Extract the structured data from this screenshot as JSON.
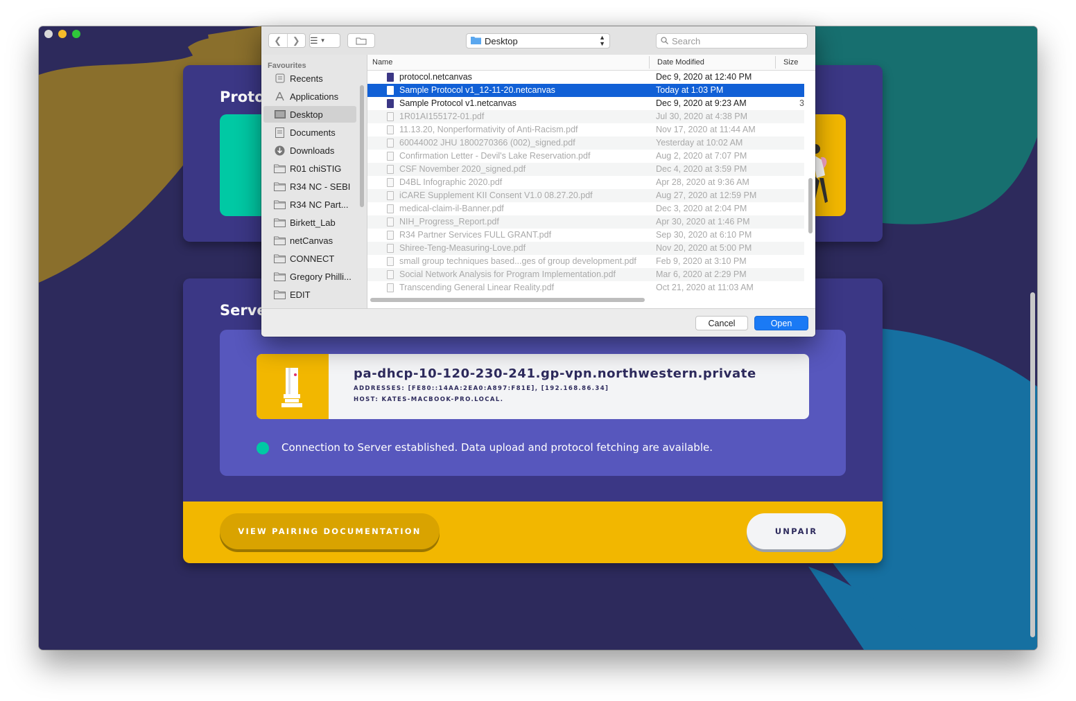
{
  "app": {
    "protocols_heading": "Protoc",
    "server_heading": "Server",
    "server": {
      "name": "pa-dhcp-10-120-230-241.gp-vpn.northwestern.private",
      "addresses": "ADDRESSES: [FE80::14AA:2EA0:A897:F81E], [192.168.86.34]",
      "host": "HOST: KATES-MACBOOK-PRO.LOCAL."
    },
    "status_text": "Connection to Server established. Data upload and protocol fetching are available.",
    "docs_button": "VIEW PAIRING DOCUMENTATION",
    "unpair_button": "UNPAIR",
    "colors": {
      "background": "#2d2a5c",
      "card": "#3b3785",
      "accent_green": "#00c9a4",
      "accent_yellow": "#f2b700",
      "panel": "#5757bd"
    }
  },
  "dialog": {
    "location": "Desktop",
    "search_placeholder": "Search",
    "sidebar": {
      "header": "Favourites",
      "items": [
        {
          "label": "Recents",
          "icon": "recents-icon"
        },
        {
          "label": "Applications",
          "icon": "applications-icon"
        },
        {
          "label": "Desktop",
          "icon": "desktop-icon",
          "active": true
        },
        {
          "label": "Documents",
          "icon": "documents-icon"
        },
        {
          "label": "Downloads",
          "icon": "downloads-icon"
        },
        {
          "label": "R01 chiSTIG",
          "icon": "folder-icon"
        },
        {
          "label": "R34 NC - SEBI",
          "icon": "folder-icon"
        },
        {
          "label": "R34 NC Part...",
          "icon": "folder-icon"
        },
        {
          "label": "Birkett_Lab",
          "icon": "folder-icon"
        },
        {
          "label": "netCanvas",
          "icon": "folder-icon"
        },
        {
          "label": "CONNECT",
          "icon": "folder-icon"
        },
        {
          "label": "Gregory Philli...",
          "icon": "folder-icon"
        },
        {
          "label": "EDIT",
          "icon": "folder-icon"
        }
      ]
    },
    "columns": {
      "name": "Name",
      "date": "Date Modified",
      "size": "Size"
    },
    "files": [
      {
        "name": "protocol.netcanvas",
        "date": "Dec 9, 2020 at 12:40 PM",
        "enabled": true
      },
      {
        "name": "Sample Protocol v1_12-11-20.netcanvas",
        "date": "Today at 1:03 PM",
        "enabled": true,
        "selected": true
      },
      {
        "name": "Sample Protocol v1.netcanvas",
        "date": "Dec 9, 2020 at 9:23 AM",
        "enabled": true,
        "trail": "3"
      },
      {
        "name": "1R01AI155172-01.pdf",
        "date": "Jul 30, 2020 at 4:38 PM"
      },
      {
        "name": "11.13.20, Nonperformativity of Anti-Racism.pdf",
        "date": "Nov 17, 2020 at 11:44 AM"
      },
      {
        "name": "60044002 JHU 1800270366 (002)_signed.pdf",
        "date": "Yesterday at 10:02 AM"
      },
      {
        "name": "Confirmation Letter - Devil's Lake Reservation.pdf",
        "date": "Aug 2, 2020 at 7:07 PM"
      },
      {
        "name": "CSF November 2020_signed.pdf",
        "date": "Dec 4, 2020 at 3:59 PM"
      },
      {
        "name": "D4BL Infographic 2020.pdf",
        "date": "Apr 28, 2020 at 9:36 AM"
      },
      {
        "name": "iCARE Supplement KII Consent V1.0 08.27.20.pdf",
        "date": "Aug 27, 2020 at 12:59 PM"
      },
      {
        "name": "medical-claim-il-Banner.pdf",
        "date": "Dec 3, 2020 at 2:04 PM"
      },
      {
        "name": "NIH_Progress_Report.pdf",
        "date": "Apr 30, 2020 at 1:46 PM"
      },
      {
        "name": "R34 Partner Services FULL GRANT.pdf",
        "date": "Sep 30, 2020 at 6:10 PM"
      },
      {
        "name": "Shiree-Teng-Measuring-Love.pdf",
        "date": "Nov 20, 2020 at 5:00 PM"
      },
      {
        "name": "small group techniques based...ges of group development.pdf",
        "date": "Feb 9, 2020 at 3:10 PM"
      },
      {
        "name": "Social Network Analysis for Program Implementation.pdf",
        "date": "Mar 6, 2020 at 2:29 PM"
      },
      {
        "name": "Transcending General Linear Reality.pdf",
        "date": "Oct 21, 2020 at 11:03 AM"
      }
    ],
    "cancel_label": "Cancel",
    "open_label": "Open"
  }
}
